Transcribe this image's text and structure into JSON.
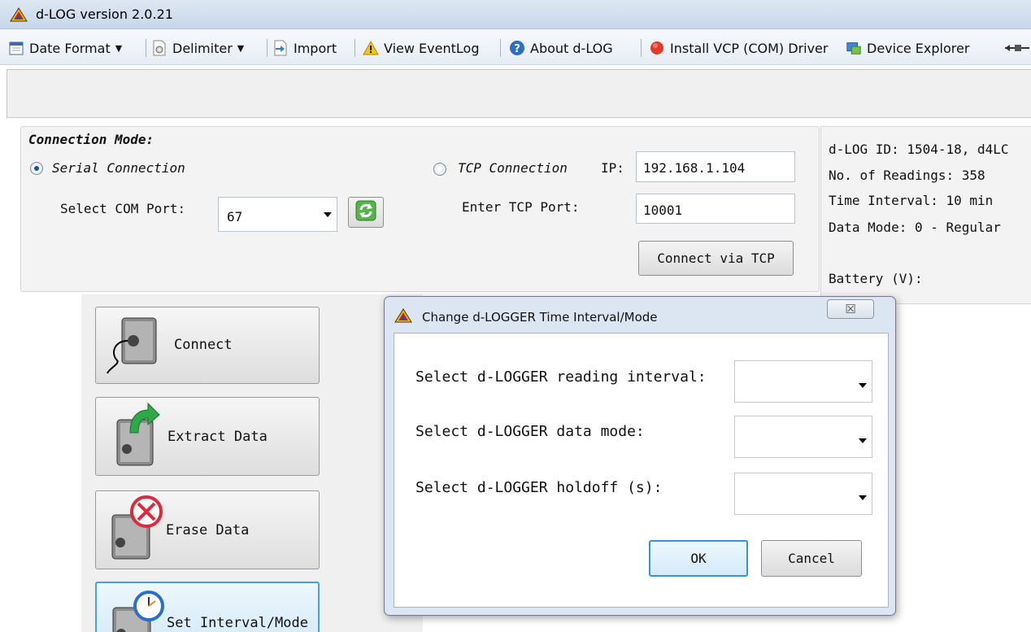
{
  "window": {
    "title": "d-LOG version 2.0.21",
    "app_icon": "d-log-triangle-icon"
  },
  "toolbar": {
    "date_format": "Date Format",
    "delimiter": "Delimiter",
    "import": "Import",
    "view_eventlog": "View EventLog",
    "about": "About d-LOG",
    "install_vcp": "Install VCP (COM) Driver",
    "device_explorer": "Device Explorer"
  },
  "connection": {
    "group_label": "Connection Mode:",
    "serial_label": "Serial Connection",
    "serial_selected": true,
    "com_port_label": "Select COM Port:",
    "com_port_value": "67",
    "tcp_label": "TCP Connection",
    "tcp_selected": false,
    "ip_label": "IP:",
    "ip_value": "192.168.1.104",
    "tcp_port_label": "Enter TCP Port:",
    "tcp_port_value": "10001",
    "connect_tcp_button": "Connect via TCP"
  },
  "info": {
    "id_line": "d-LOG ID: 1504-18, d4LC",
    "readings_line": "No. of Readings: 358",
    "interval_line": "Time Interval: 10 min",
    "mode_line": "Data Mode: 0 - Regular",
    "battery_line": "Battery (V):"
  },
  "actions": {
    "connect": "Connect",
    "extract": "Extract Data",
    "erase": "Erase Data",
    "set_interval": "Set Interval/Mode"
  },
  "dialog": {
    "title": "Change d-LOGGER Time Interval/Mode",
    "close_glyph": "☒",
    "interval_label": "Select d-LOGGER reading interval:",
    "interval_value": "",
    "mode_label": "Select d-LOGGER data mode:",
    "mode_value": "",
    "holdoff_label": "Select d-LOGGER holdoff (s):",
    "holdoff_value": "",
    "ok": "OK",
    "cancel": "Cancel"
  },
  "colors": {
    "accent_selected": "#4aa2dd",
    "dialog_frame": "#dbe6f2"
  }
}
